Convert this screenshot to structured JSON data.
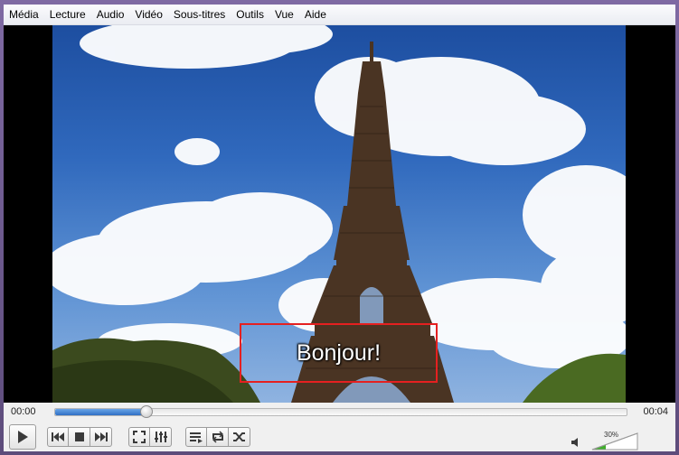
{
  "menubar": {
    "items": [
      {
        "label": "Média"
      },
      {
        "label": "Lecture"
      },
      {
        "label": "Audio"
      },
      {
        "label": "Vidéo"
      },
      {
        "label": "Sous-titres"
      },
      {
        "label": "Outils"
      },
      {
        "label": "Vue"
      },
      {
        "label": "Aide"
      }
    ]
  },
  "video": {
    "subtitle": "Bonjour!"
  },
  "playback": {
    "elapsed": "00:00",
    "total": "00:04",
    "progress_fraction": 0.16
  },
  "volume": {
    "label": "30%",
    "level_fraction": 0.3
  },
  "icons": {
    "play": "play-icon",
    "prev": "previous-icon",
    "stop": "stop-icon",
    "next": "next-icon",
    "fullscreen": "fullscreen-icon",
    "extended": "equalizer-icon",
    "playlist": "playlist-icon",
    "loop": "loop-icon",
    "random": "shuffle-icon",
    "speaker": "speaker-icon"
  },
  "colors": {
    "subtitle_box": "#e52020",
    "seek_fill": "#2f6fc5",
    "volume_fill": "#3fae2a"
  }
}
